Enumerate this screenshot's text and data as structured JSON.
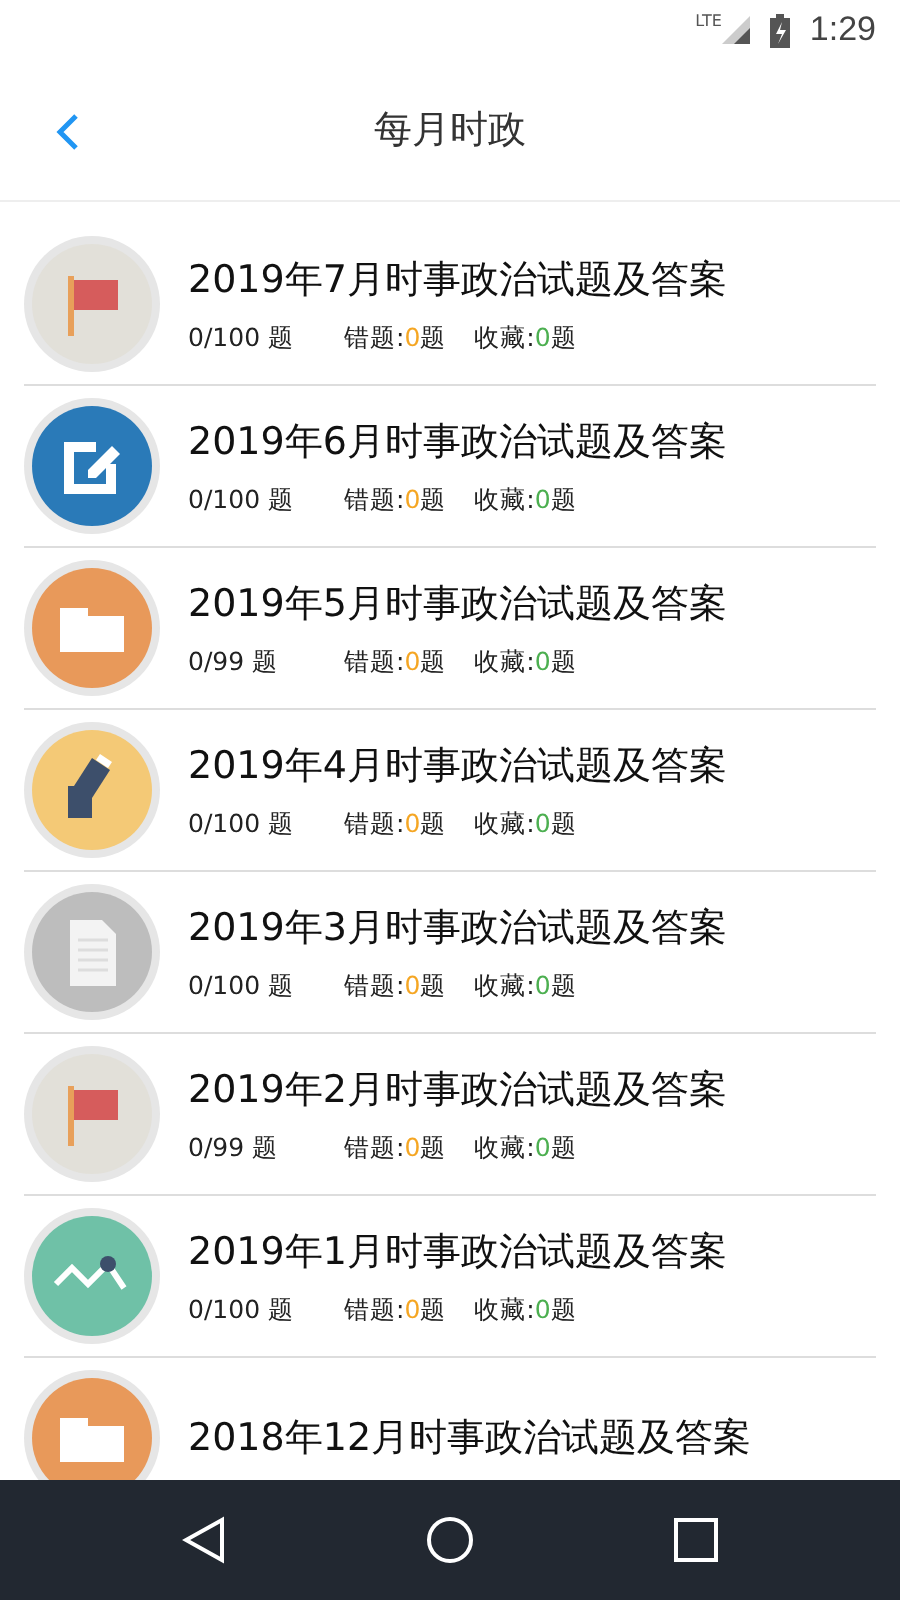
{
  "status_bar": {
    "network": "LTE",
    "time": "1:29"
  },
  "header": {
    "title": "每月时政"
  },
  "items": [
    {
      "kind": "flag",
      "title": "2019年7月时事政治试题及答案",
      "progress": "0/100 题",
      "wrong": {
        "label": "错题:",
        "count": "0",
        "unit": "题"
      },
      "favorites": {
        "label": "收藏:",
        "count": "0",
        "unit": "题"
      }
    },
    {
      "kind": "edit",
      "title": "2019年6月时事政治试题及答案",
      "progress": "0/100 题",
      "wrong": {
        "label": "错题:",
        "count": "0",
        "unit": "题"
      },
      "favorites": {
        "label": "收藏:",
        "count": "0",
        "unit": "题"
      }
    },
    {
      "kind": "folder",
      "title": "2019年5月时事政治试题及答案",
      "progress": "0/99 题",
      "wrong": {
        "label": "错题:",
        "count": "0",
        "unit": "题"
      },
      "favorites": {
        "label": "收藏:",
        "count": "0",
        "unit": "题"
      }
    },
    {
      "kind": "pencil",
      "title": "2019年4月时事政治试题及答案",
      "progress": "0/100 题",
      "wrong": {
        "label": "错题:",
        "count": "0",
        "unit": "题"
      },
      "favorites": {
        "label": "收藏:",
        "count": "0",
        "unit": "题"
      }
    },
    {
      "kind": "document",
      "title": "2019年3月时事政治试题及答案",
      "progress": "0/100 题",
      "wrong": {
        "label": "错题:",
        "count": "0",
        "unit": "题"
      },
      "favorites": {
        "label": "收藏:",
        "count": "0",
        "unit": "题"
      }
    },
    {
      "kind": "flag",
      "title": "2019年2月时事政治试题及答案",
      "progress": "0/99 题",
      "wrong": {
        "label": "错题:",
        "count": "0",
        "unit": "题"
      },
      "favorites": {
        "label": "收藏:",
        "count": "0",
        "unit": "题"
      }
    },
    {
      "kind": "chart",
      "title": "2019年1月时事政治试题及答案",
      "progress": "0/100 题",
      "wrong": {
        "label": "错题:",
        "count": "0",
        "unit": "题"
      },
      "favorites": {
        "label": "收藏:",
        "count": "0",
        "unit": "题"
      }
    },
    {
      "kind": "folder",
      "title": "2018年12月时事政治试题及答案"
    }
  ]
}
